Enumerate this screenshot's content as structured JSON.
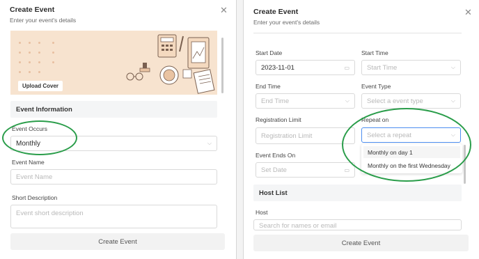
{
  "left": {
    "title": "Create Event",
    "subtitle": "Enter your event's details",
    "upload_cover": "Upload Cover",
    "section_event_info": "Event Information",
    "event_occurs": {
      "label": "Event Occurs",
      "value": "Monthly"
    },
    "event_name": {
      "label": "Event Name",
      "placeholder": "Event Name"
    },
    "short_description": {
      "label": "Short Description",
      "placeholder": "Event short description"
    },
    "submit": "Create Event"
  },
  "right": {
    "title": "Create Event",
    "subtitle": "Enter your event's details",
    "start_date": {
      "label": "Start Date",
      "value": "2023-11-01"
    },
    "start_time": {
      "label": "Start Time",
      "placeholder": "Start Time"
    },
    "end_time": {
      "label": "End Time",
      "placeholder": "End Time"
    },
    "event_type": {
      "label": "Event Type",
      "placeholder": "Select a event type"
    },
    "registration_limit": {
      "label": "Registration Limit",
      "placeholder": "Registration Limit"
    },
    "repeat_on": {
      "label": "Repeat on",
      "placeholder": "Select a repeat",
      "options": [
        "Monthly on day 1",
        "Monthly on the first Wednesday"
      ]
    },
    "event_ends_on": {
      "label": "Event Ends On",
      "placeholder": "Set Date"
    },
    "section_host_list": "Host List",
    "host": {
      "label": "Host",
      "placeholder": "Search for names or email"
    },
    "submit": "Create Event"
  },
  "colors": {
    "highlight_oval": "#2a9d4a",
    "cover_bg": "#f7e3cf",
    "section_bg": "#f4f5f6"
  },
  "icons": [
    "close-icon",
    "chevron-down-icon",
    "calendar-icon"
  ]
}
